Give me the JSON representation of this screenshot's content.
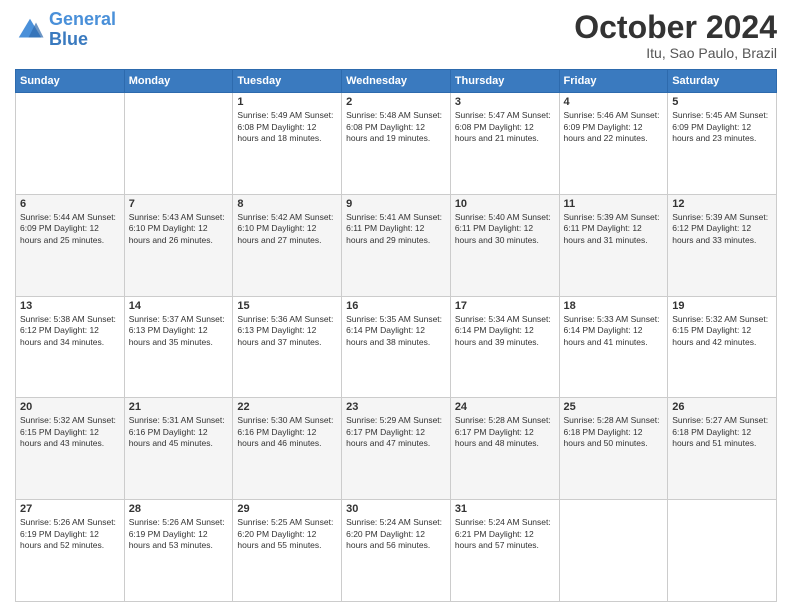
{
  "logo": {
    "line1": "General",
    "line2": "Blue"
  },
  "header": {
    "title": "October 2024",
    "location": "Itu, Sao Paulo, Brazil"
  },
  "weekdays": [
    "Sunday",
    "Monday",
    "Tuesday",
    "Wednesday",
    "Thursday",
    "Friday",
    "Saturday"
  ],
  "weeks": [
    [
      {
        "day": "",
        "info": ""
      },
      {
        "day": "",
        "info": ""
      },
      {
        "day": "1",
        "info": "Sunrise: 5:49 AM\nSunset: 6:08 PM\nDaylight: 12 hours and 18 minutes."
      },
      {
        "day": "2",
        "info": "Sunrise: 5:48 AM\nSunset: 6:08 PM\nDaylight: 12 hours and 19 minutes."
      },
      {
        "day": "3",
        "info": "Sunrise: 5:47 AM\nSunset: 6:08 PM\nDaylight: 12 hours and 21 minutes."
      },
      {
        "day": "4",
        "info": "Sunrise: 5:46 AM\nSunset: 6:09 PM\nDaylight: 12 hours and 22 minutes."
      },
      {
        "day": "5",
        "info": "Sunrise: 5:45 AM\nSunset: 6:09 PM\nDaylight: 12 hours and 23 minutes."
      }
    ],
    [
      {
        "day": "6",
        "info": "Sunrise: 5:44 AM\nSunset: 6:09 PM\nDaylight: 12 hours and 25 minutes."
      },
      {
        "day": "7",
        "info": "Sunrise: 5:43 AM\nSunset: 6:10 PM\nDaylight: 12 hours and 26 minutes."
      },
      {
        "day": "8",
        "info": "Sunrise: 5:42 AM\nSunset: 6:10 PM\nDaylight: 12 hours and 27 minutes."
      },
      {
        "day": "9",
        "info": "Sunrise: 5:41 AM\nSunset: 6:11 PM\nDaylight: 12 hours and 29 minutes."
      },
      {
        "day": "10",
        "info": "Sunrise: 5:40 AM\nSunset: 6:11 PM\nDaylight: 12 hours and 30 minutes."
      },
      {
        "day": "11",
        "info": "Sunrise: 5:39 AM\nSunset: 6:11 PM\nDaylight: 12 hours and 31 minutes."
      },
      {
        "day": "12",
        "info": "Sunrise: 5:39 AM\nSunset: 6:12 PM\nDaylight: 12 hours and 33 minutes."
      }
    ],
    [
      {
        "day": "13",
        "info": "Sunrise: 5:38 AM\nSunset: 6:12 PM\nDaylight: 12 hours and 34 minutes."
      },
      {
        "day": "14",
        "info": "Sunrise: 5:37 AM\nSunset: 6:13 PM\nDaylight: 12 hours and 35 minutes."
      },
      {
        "day": "15",
        "info": "Sunrise: 5:36 AM\nSunset: 6:13 PM\nDaylight: 12 hours and 37 minutes."
      },
      {
        "day": "16",
        "info": "Sunrise: 5:35 AM\nSunset: 6:14 PM\nDaylight: 12 hours and 38 minutes."
      },
      {
        "day": "17",
        "info": "Sunrise: 5:34 AM\nSunset: 6:14 PM\nDaylight: 12 hours and 39 minutes."
      },
      {
        "day": "18",
        "info": "Sunrise: 5:33 AM\nSunset: 6:14 PM\nDaylight: 12 hours and 41 minutes."
      },
      {
        "day": "19",
        "info": "Sunrise: 5:32 AM\nSunset: 6:15 PM\nDaylight: 12 hours and 42 minutes."
      }
    ],
    [
      {
        "day": "20",
        "info": "Sunrise: 5:32 AM\nSunset: 6:15 PM\nDaylight: 12 hours and 43 minutes."
      },
      {
        "day": "21",
        "info": "Sunrise: 5:31 AM\nSunset: 6:16 PM\nDaylight: 12 hours and 45 minutes."
      },
      {
        "day": "22",
        "info": "Sunrise: 5:30 AM\nSunset: 6:16 PM\nDaylight: 12 hours and 46 minutes."
      },
      {
        "day": "23",
        "info": "Sunrise: 5:29 AM\nSunset: 6:17 PM\nDaylight: 12 hours and 47 minutes."
      },
      {
        "day": "24",
        "info": "Sunrise: 5:28 AM\nSunset: 6:17 PM\nDaylight: 12 hours and 48 minutes."
      },
      {
        "day": "25",
        "info": "Sunrise: 5:28 AM\nSunset: 6:18 PM\nDaylight: 12 hours and 50 minutes."
      },
      {
        "day": "26",
        "info": "Sunrise: 5:27 AM\nSunset: 6:18 PM\nDaylight: 12 hours and 51 minutes."
      }
    ],
    [
      {
        "day": "27",
        "info": "Sunrise: 5:26 AM\nSunset: 6:19 PM\nDaylight: 12 hours and 52 minutes."
      },
      {
        "day": "28",
        "info": "Sunrise: 5:26 AM\nSunset: 6:19 PM\nDaylight: 12 hours and 53 minutes."
      },
      {
        "day": "29",
        "info": "Sunrise: 5:25 AM\nSunset: 6:20 PM\nDaylight: 12 hours and 55 minutes."
      },
      {
        "day": "30",
        "info": "Sunrise: 5:24 AM\nSunset: 6:20 PM\nDaylight: 12 hours and 56 minutes."
      },
      {
        "day": "31",
        "info": "Sunrise: 5:24 AM\nSunset: 6:21 PM\nDaylight: 12 hours and 57 minutes."
      },
      {
        "day": "",
        "info": ""
      },
      {
        "day": "",
        "info": ""
      }
    ]
  ]
}
